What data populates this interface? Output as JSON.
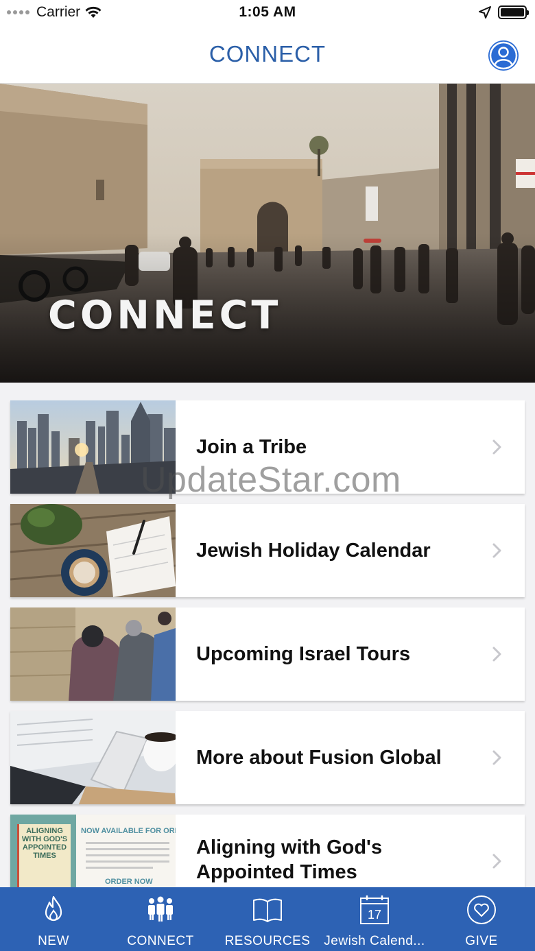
{
  "status_bar": {
    "carrier": "Carrier",
    "time": "1:05 AM"
  },
  "nav": {
    "title": "CONNECT",
    "profile_icon": "user-circle-icon"
  },
  "hero": {
    "text": "CONNECT"
  },
  "cards": [
    {
      "label": "Join a Tribe"
    },
    {
      "label": "Jewish Holiday Calendar"
    },
    {
      "label": "Upcoming Israel Tours"
    },
    {
      "label": "More about Fusion Global"
    },
    {
      "label": "Aligning with God's Appointed Times"
    }
  ],
  "book_promo": {
    "cover_text": "ALIGNING WITH GOD'S APPOINTED TIMES",
    "headline": "NOW AVAILABLE FOR ORDER",
    "cta": "ORDER NOW"
  },
  "watermark": "UpdateStar.com",
  "tab_bar": {
    "tabs": [
      {
        "label": "NEW",
        "icon": "flame-icon"
      },
      {
        "label": "CONNECT",
        "icon": "people-icon"
      },
      {
        "label": "RESOURCES",
        "icon": "book-icon"
      },
      {
        "label": "Jewish Calend...",
        "icon": "calendar-icon",
        "day": "17"
      },
      {
        "label": "GIVE",
        "icon": "heart-icon"
      }
    ]
  },
  "colors": {
    "brand_blue": "#2d62b4",
    "title_blue": "#2b5fa8",
    "background": "#f2f2f4"
  }
}
